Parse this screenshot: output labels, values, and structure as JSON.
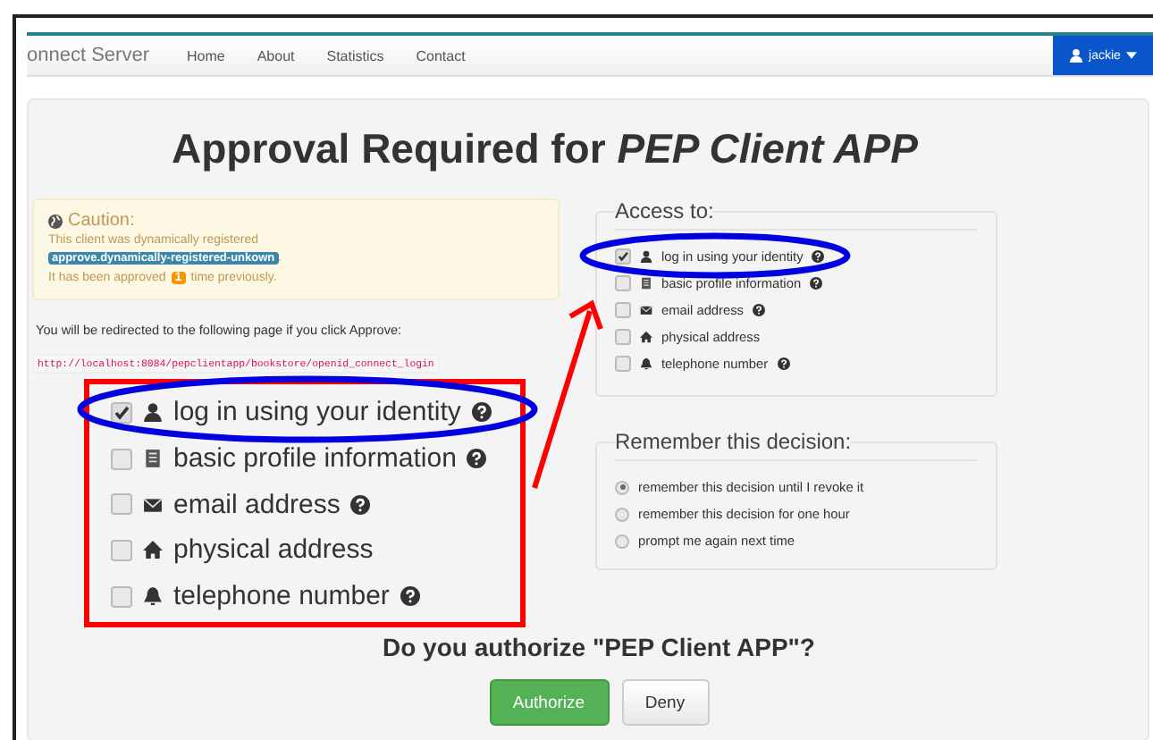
{
  "navbar": {
    "brand": "onnect Server",
    "links": [
      "Home",
      "About",
      "Statistics",
      "Contact"
    ],
    "user": "jackie"
  },
  "title": "Approval Required for  *PEP Client APP*",
  "caution": {
    "heading": "Caution:",
    "text": "This client was dynamically registered",
    "label": "approve.dynamically-registered-unkown",
    "after_label": ".",
    "approved_before": "It has been approved",
    "count": "1",
    "approved_after": "time previously."
  },
  "redirect": {
    "text": "You will be redirected to the following page if you click Approve:",
    "url": "http://localhost:8084/pepclientapp/bookstore/openid_connect_login"
  },
  "scopes": [
    {
      "kind": "identity",
      "label": "log in using your identity",
      "checked": true,
      "help": true
    },
    {
      "kind": "profile",
      "label": "basic profile information",
      "checked": false,
      "help": true
    },
    {
      "kind": "email",
      "label": "email address",
      "checked": false,
      "help": true
    },
    {
      "kind": "address",
      "label": "physical address",
      "checked": false,
      "help": false
    },
    {
      "kind": "phone",
      "label": "telephone number",
      "checked": false,
      "help": true
    }
  ],
  "access": {
    "title": "Access to:",
    "scopes": [
      {
        "kind": "identity",
        "label": "log in using your identity",
        "checked": true,
        "help": true
      },
      {
        "kind": "profile",
        "label": "basic profile information",
        "checked": false,
        "help": true
      },
      {
        "kind": "email",
        "label": "email address",
        "checked": false,
        "help": true
      },
      {
        "kind": "address",
        "label": "physical address",
        "checked": false,
        "help": false
      },
      {
        "kind": "phone",
        "label": "telephone number",
        "checked": false,
        "help": true
      }
    ]
  },
  "remember": {
    "title": "Remember this decision:",
    "options": [
      {
        "label": "remember this decision until I revoke it",
        "selected": true
      },
      {
        "label": "remember this decision for one hour",
        "selected": false
      },
      {
        "label": "prompt me again next time",
        "selected": false
      }
    ]
  },
  "question": "Do you authorize \"PEP Client APP\"?",
  "buttons": [
    {
      "kind": "primary",
      "label": "Authorize"
    },
    {
      "kind": "default",
      "label": "Deny"
    }
  ]
}
